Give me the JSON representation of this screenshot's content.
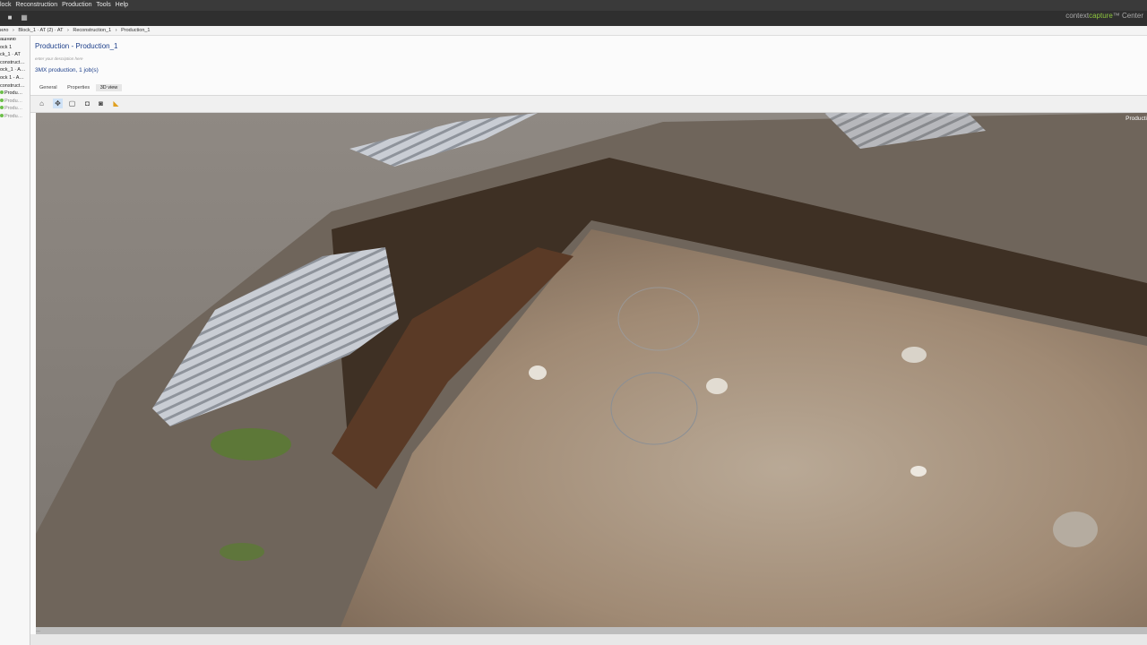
{
  "menu": {
    "items": [
      "lock",
      "Reconstruction",
      "Production",
      "Tools",
      "Help"
    ]
  },
  "brand": {
    "prefix": "context",
    "highlight": "capture",
    "suffix": "™ Center"
  },
  "breadcrumb": [
    "ило",
    "›",
    "Block_1 · AT (2) · AT",
    "›",
    "Reconstruction_1",
    "›",
    "Production_1"
  ],
  "tree": [
    {
      "label": "ашнию",
      "dot": false,
      "muted": false
    },
    {
      "label": "ock 1",
      "dot": false,
      "muted": false
    },
    {
      "label": "ck_1 · AT",
      "dot": false,
      "muted": false
    },
    {
      "label": "construct…",
      "dot": false,
      "muted": false
    },
    {
      "label": "ock_1 · A…",
      "dot": false,
      "muted": false
    },
    {
      "label": "ock 1 - A…",
      "dot": false,
      "muted": false
    },
    {
      "label": "construct…",
      "dot": false,
      "muted": false
    },
    {
      "label": "Produ…",
      "dot": true,
      "muted": false
    },
    {
      "label": "Produ…",
      "dot": true,
      "muted": true
    },
    {
      "label": "Produ…",
      "dot": true,
      "muted": true
    },
    {
      "label": "Produ…",
      "dot": true,
      "muted": true
    }
  ],
  "page": {
    "title": "Production - Production_1",
    "description_placeholder": "enter your description here",
    "summary": "3MX production, 1 job(s)"
  },
  "tabs": [
    {
      "label": "General",
      "active": false
    },
    {
      "label": "Properties",
      "active": false
    },
    {
      "label": "3D view",
      "active": true
    }
  ],
  "viewport": {
    "corner_label": "Producti"
  },
  "statusbar": {
    "text": "…"
  },
  "colors": {
    "brand_green": "#8ec63f",
    "title_blue": "#1d3f8a"
  }
}
